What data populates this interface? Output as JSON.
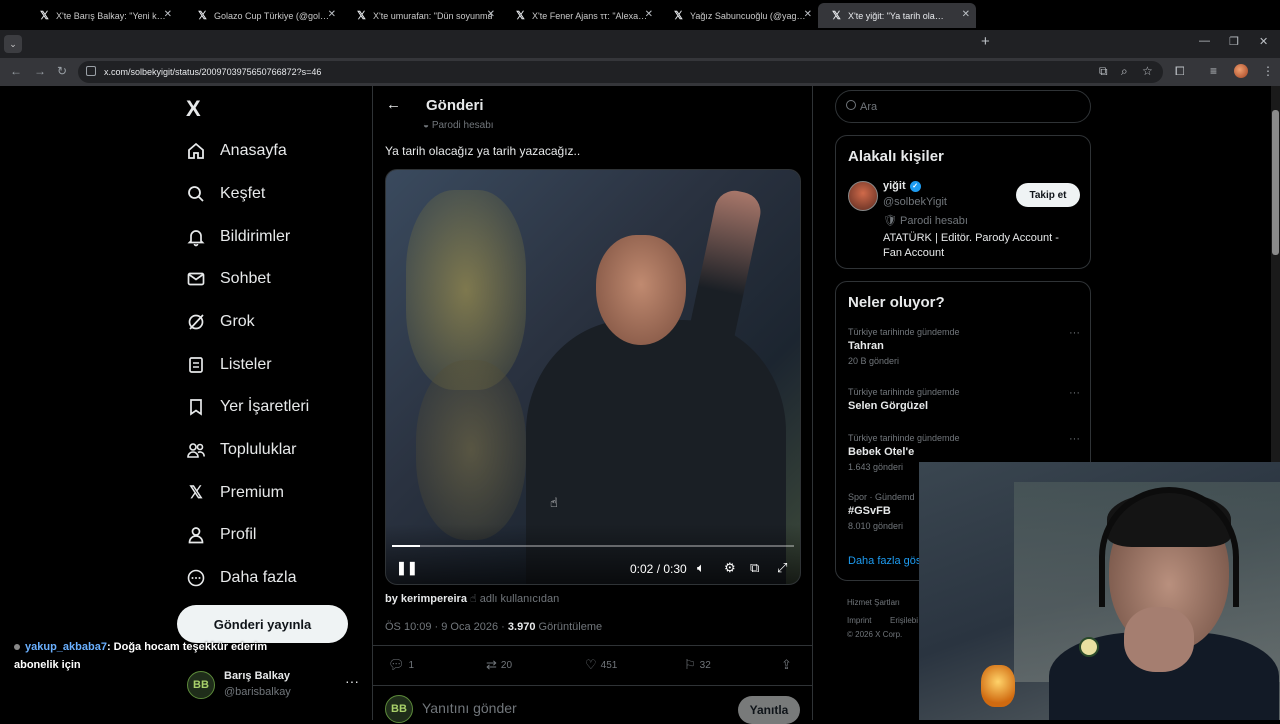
{
  "browser": {
    "tabs": [
      {
        "title": "X'te Barış Balkay: \"Yeni kamera",
        "active": false
      },
      {
        "title": "Golazo Cup Türkiye (@golazoc",
        "active": false
      },
      {
        "title": "X'te umurafan: \"Dün soyunma",
        "active": false
      },
      {
        "title": "X'te Fener Ajans ττ: \"Alexander",
        "active": false
      },
      {
        "title": "Yağız Sabuncuoğlu (@yagosab",
        "active": false
      },
      {
        "title": "X'te yiğit: \"Ya tarih olacağız",
        "active": true
      }
    ],
    "url": "x.com/solbekyigit/status/2009703975650766872?s=46",
    "new_tab": "+",
    "minimize": "—",
    "restore": "❐",
    "close": "✕"
  },
  "nav": {
    "logo": "X",
    "items": [
      {
        "label": "Anasayfa",
        "icon": "home-icon"
      },
      {
        "label": "Keşfet",
        "icon": "search-icon"
      },
      {
        "label": "Bildirimler",
        "icon": "bell-icon"
      },
      {
        "label": "Sohbet",
        "icon": "mail-icon"
      },
      {
        "label": "Grok",
        "icon": "grok-icon"
      },
      {
        "label": "Listeler",
        "icon": "list-icon"
      },
      {
        "label": "Yer İşaretleri",
        "icon": "bookmark-icon"
      },
      {
        "label": "Topluluklar",
        "icon": "communities-icon"
      },
      {
        "label": "Premium",
        "icon": "x-premium-icon"
      },
      {
        "label": "Profil",
        "icon": "person-icon"
      },
      {
        "label": "Daha fazla",
        "icon": "more-circle-icon"
      }
    ],
    "post_button": "Gönderi yayınla",
    "account": {
      "name": "Barış Balkay",
      "handle": "@barisbalkay",
      "initials": "BB"
    }
  },
  "post": {
    "header_title": "Gönderi",
    "parody_label": "Parodi hesabı",
    "text": "Ya tarih olacağız ya tarih yazacağız..",
    "video": {
      "time": "0:02 / 0:30",
      "progress": 0.07
    },
    "byline_user": "by kerimpereira",
    "byline_suffix": "adlı kullanıcıdan",
    "timestamp": "ÖS 10:09 · 9 Oca 2026 ·",
    "views_count": "3.970",
    "views_label": "Görüntüleme",
    "actions": {
      "replies": "1",
      "reposts": "20",
      "likes": "451",
      "bookmarks": "32"
    },
    "reply_placeholder": "Yanıtını gönder",
    "reply_button": "Yanıtla"
  },
  "sidebar": {
    "search_placeholder": "Ara",
    "related": {
      "title": "Alakalı kişiler",
      "name": "yiğit",
      "handle": "@solbekYigit",
      "parody": "Parodi hesabı",
      "bio": "ATATÜRK | Editör. Parody Account - Fan Account",
      "follow": "Takip et"
    },
    "trends": {
      "title": "Neler oluyor?",
      "items": [
        {
          "context": "Türkiye tarihinde gündemde",
          "name": "Tahran",
          "count": "20 B gönderi"
        },
        {
          "context": "Türkiye tarihinde gündemde",
          "name": "Selen Görgüzel",
          "count": ""
        },
        {
          "context": "Türkiye tarihinde gündemde",
          "name": "Bebek Otel'e",
          "count": "1.643 gönderi"
        },
        {
          "context": "Spor · Gündemd",
          "name": "#GSvFB",
          "count": "8.010 gönderi"
        }
      ],
      "show_more": "Daha fazla gös"
    },
    "footer": [
      "Hizmet Şartları",
      "Imprint",
      "Erişilebi",
      "© 2026 X Corp."
    ]
  },
  "stream": {
    "chat_user": "yakup_akbaba7",
    "chat_text": ": Doğa hocam teşekkür ederim abonelik için"
  }
}
